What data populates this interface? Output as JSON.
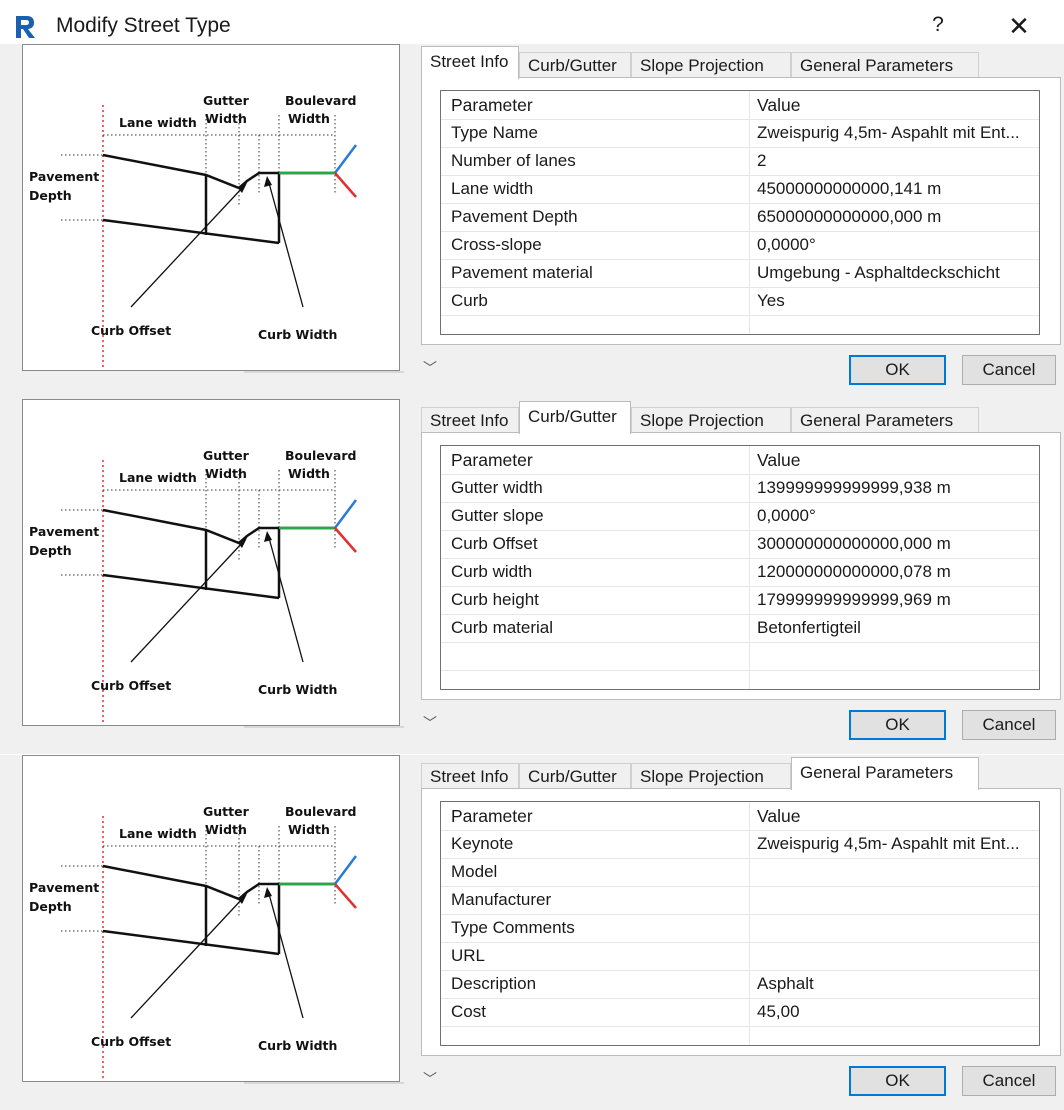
{
  "window": {
    "title": "Modify Street Type",
    "help_label": "?",
    "close_label": "✕",
    "app_icon": "revit-logo-icon"
  },
  "diagram_labels": {
    "gutter": "Gutter",
    "width": "Width",
    "boulevard": "Boulevard",
    "lane_width": "Lane width",
    "pavement": "Pavement",
    "depth": "Depth",
    "curb_offset": "Curb Offset",
    "curb_width": "Curb Width"
  },
  "tab_labels": [
    "Street Info",
    "Curb/Gutter",
    "Slope Projection",
    "General Parameters"
  ],
  "header": {
    "parameter": "Parameter",
    "value": "Value"
  },
  "buttons": {
    "ok": "OK",
    "cancel": "Cancel",
    "dropdown": "﹀"
  },
  "panels": [
    {
      "active_tab": "Street Info",
      "rows": [
        {
          "parameter": "Type Name",
          "value": "Zweispurig 4,5m- Aspahlt mit Ent..."
        },
        {
          "parameter": "Number of lanes",
          "value": "2"
        },
        {
          "parameter": "Lane width",
          "value": "45000000000000,141 m"
        },
        {
          "parameter": "Pavement Depth",
          "value": "65000000000000,000 m"
        },
        {
          "parameter": "Cross-slope",
          "value": "0,0000°"
        },
        {
          "parameter": "Pavement material",
          "value": "Umgebung - Asphaltdeckschicht"
        },
        {
          "parameter": "Curb",
          "value": "Yes"
        }
      ]
    },
    {
      "active_tab": "Curb/Gutter",
      "rows": [
        {
          "parameter": "Gutter width",
          "value": "139999999999999,938 m"
        },
        {
          "parameter": "Gutter slope",
          "value": "0,0000°"
        },
        {
          "parameter": "Curb Offset",
          "value": "300000000000000,000 m"
        },
        {
          "parameter": "Curb width",
          "value": "120000000000000,078 m"
        },
        {
          "parameter": "Curb height",
          "value": "179999999999999,969 m"
        },
        {
          "parameter": "Curb material",
          "value": "Betonfertigteil"
        },
        {
          "parameter": "",
          "value": ""
        }
      ]
    },
    {
      "active_tab": "General Parameters",
      "rows": [
        {
          "parameter": "Keynote",
          "value": "Zweispurig 4,5m- Aspahlt mit Ent..."
        },
        {
          "parameter": "Model",
          "value": ""
        },
        {
          "parameter": "Manufacturer",
          "value": ""
        },
        {
          "parameter": "Type Comments",
          "value": ""
        },
        {
          "parameter": "URL",
          "value": ""
        },
        {
          "parameter": "Description",
          "value": "Asphalt"
        },
        {
          "parameter": "Cost",
          "value": "45,00"
        }
      ]
    }
  ],
  "colors": {
    "ok_border": "#0078d7",
    "logo": "#1a5fb4",
    "axis_green": "#22aa44",
    "axis_red": "#e03030",
    "axis_blue": "#2a7ad6",
    "guide_red": "#e03030"
  }
}
